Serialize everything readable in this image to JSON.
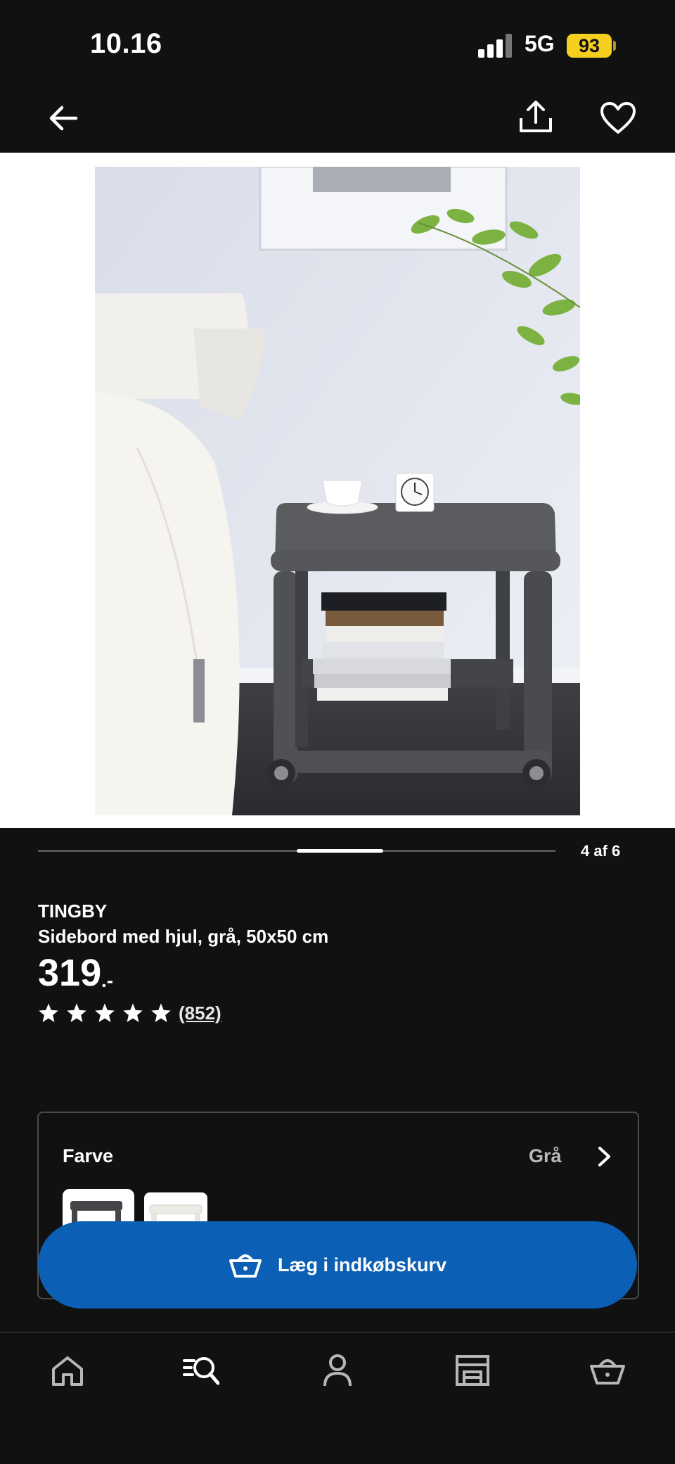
{
  "status_bar": {
    "time": "10.16",
    "network": "5G",
    "battery": "93"
  },
  "gallery": {
    "counter": "4 af 6",
    "current": 4,
    "total": 6
  },
  "product": {
    "name": "TINGBY",
    "description": "Sidebord med hjul, grå, 50x50 cm",
    "price": "319",
    "price_suffix": ".-",
    "rating": 5,
    "reviews": "(852)"
  },
  "color_selector": {
    "label": "Farve",
    "value": "Grå"
  },
  "cta": {
    "label": "Læg i indkøbskurv"
  },
  "bottom_nav": {
    "items": [
      {
        "icon": "home-icon"
      },
      {
        "icon": "search-list-icon"
      },
      {
        "icon": "profile-icon"
      },
      {
        "icon": "store-icon"
      },
      {
        "icon": "basket-icon"
      }
    ]
  },
  "colors": {
    "background": "#111111",
    "accent_blue": "#0b5fb5",
    "battery": "#f5cf1f"
  }
}
